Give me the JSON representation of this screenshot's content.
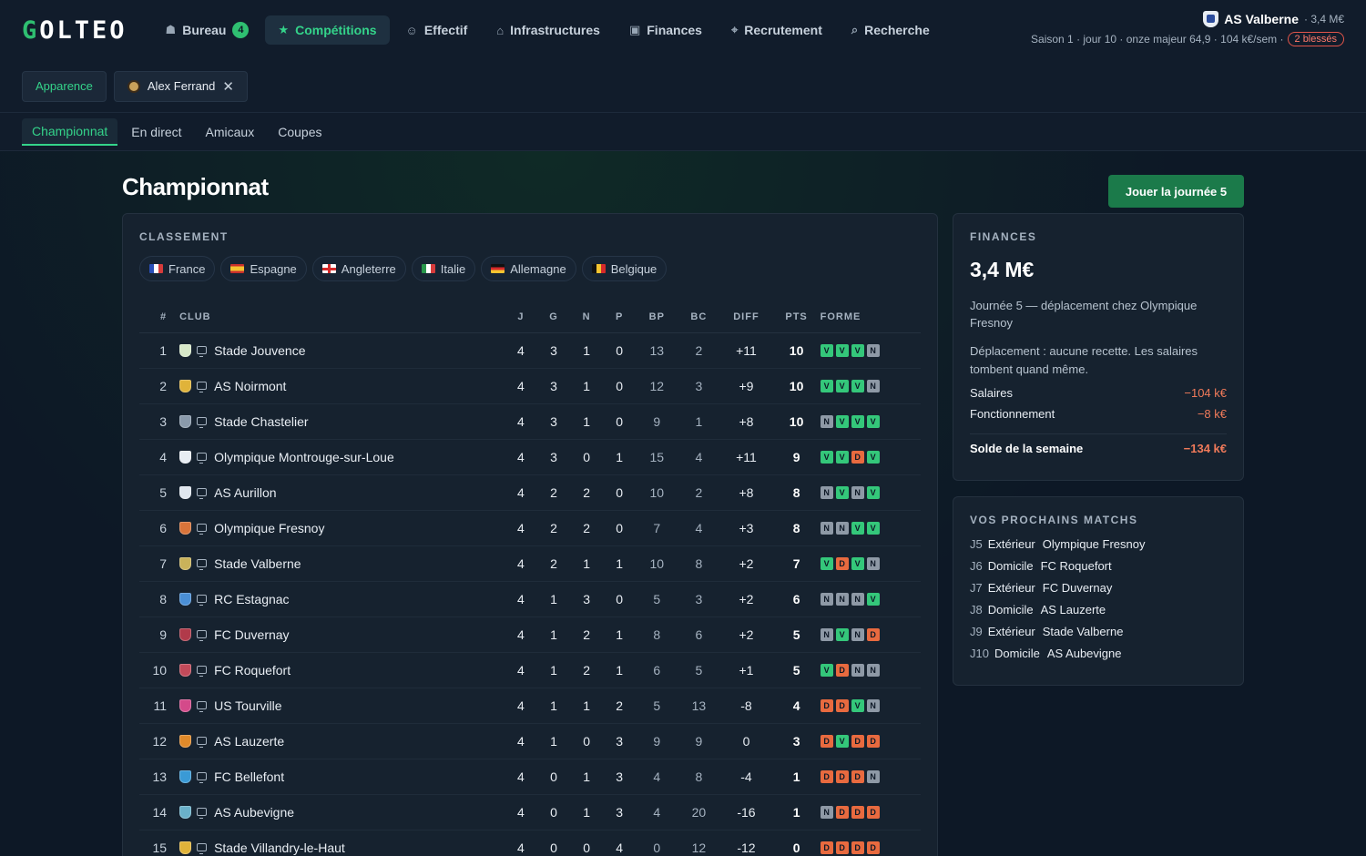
{
  "app": {
    "logo": "GOLTEO"
  },
  "nav": [
    {
      "label": "Bureau",
      "icon": "briefcase-icon",
      "glyph": "☗",
      "badge": "4",
      "active": false
    },
    {
      "label": "Compétitions",
      "icon": "trophy-icon",
      "glyph": "★",
      "badge": null,
      "active": true
    },
    {
      "label": "Effectif",
      "icon": "users-icon",
      "glyph": "☺",
      "badge": null,
      "active": false
    },
    {
      "label": "Infrastructures",
      "icon": "stadium-icon",
      "glyph": "⌂",
      "badge": null,
      "active": false
    },
    {
      "label": "Finances",
      "icon": "banknote-icon",
      "glyph": "▣",
      "badge": null,
      "active": false
    },
    {
      "label": "Recrutement",
      "icon": "scout-icon",
      "glyph": "⌖",
      "badge": null,
      "active": false
    },
    {
      "label": "Recherche",
      "icon": "search-icon",
      "glyph": "⌕",
      "badge": null,
      "active": false
    }
  ],
  "club": {
    "name": "AS Valberne",
    "budget": "· 3,4 M€",
    "status": "Saison 1 · jour 10 · onze majeur 64,9 · 104 k€/sem ·",
    "injuries": "2 blessés"
  },
  "toolbar": {
    "appearance": "Apparence",
    "user": "Alex Ferrand"
  },
  "tabs": [
    {
      "label": "Championnat",
      "active": true
    },
    {
      "label": "En direct",
      "active": false
    },
    {
      "label": "Amicaux",
      "active": false
    },
    {
      "label": "Coupes",
      "active": false
    }
  ],
  "page": {
    "title": "Championnat",
    "play_button": "Jouer la journée 5"
  },
  "standings": {
    "label": "CLASSEMENT",
    "countries": [
      {
        "name": "France",
        "flag": "flag-fr"
      },
      {
        "name": "Espagne",
        "flag": "flag-es"
      },
      {
        "name": "Angleterre",
        "flag": "flag-en"
      },
      {
        "name": "Italie",
        "flag": "flag-it"
      },
      {
        "name": "Allemagne",
        "flag": "flag-de"
      },
      {
        "name": "Belgique",
        "flag": "flag-be"
      }
    ],
    "columns": [
      "#",
      "CLUB",
      "J",
      "G",
      "N",
      "P",
      "BP",
      "BC",
      "DIFF",
      "PTS",
      "FORME"
    ],
    "rows": [
      {
        "pos": "1",
        "club": "Stade Jouvence",
        "crest": "#d7e8c9",
        "j": "4",
        "g": "3",
        "n": "1",
        "p": "0",
        "bp": "13",
        "bc": "2",
        "diff": "+11",
        "pts": "10",
        "form": [
          "V",
          "V",
          "V",
          "N"
        ]
      },
      {
        "pos": "2",
        "club": "AS Noirmont",
        "crest": "#e0b33a",
        "j": "4",
        "g": "3",
        "n": "1",
        "p": "0",
        "bp": "12",
        "bc": "3",
        "diff": "+9",
        "pts": "10",
        "form": [
          "V",
          "V",
          "V",
          "N"
        ]
      },
      {
        "pos": "3",
        "club": "Stade Chastelier",
        "crest": "#8a9aab",
        "j": "4",
        "g": "3",
        "n": "1",
        "p": "0",
        "bp": "9",
        "bc": "1",
        "diff": "+8",
        "pts": "10",
        "form": [
          "N",
          "V",
          "V",
          "V"
        ]
      },
      {
        "pos": "4",
        "club": "Olympique Montrouge-sur-Loue",
        "crest": "#e8edf3",
        "j": "4",
        "g": "3",
        "n": "0",
        "p": "1",
        "bp": "15",
        "bc": "4",
        "diff": "+11",
        "pts": "9",
        "form": [
          "V",
          "V",
          "D",
          "V"
        ]
      },
      {
        "pos": "5",
        "club": "AS Aurillon",
        "crest": "#dfe6ee",
        "j": "4",
        "g": "2",
        "n": "2",
        "p": "0",
        "bp": "10",
        "bc": "2",
        "diff": "+8",
        "pts": "8",
        "form": [
          "N",
          "V",
          "N",
          "V"
        ]
      },
      {
        "pos": "6",
        "club": "Olympique Fresnoy",
        "crest": "#d9743a",
        "j": "4",
        "g": "2",
        "n": "2",
        "p": "0",
        "bp": "7",
        "bc": "4",
        "diff": "+3",
        "pts": "8",
        "form": [
          "N",
          "N",
          "V",
          "V"
        ]
      },
      {
        "pos": "7",
        "club": "Stade Valberne",
        "crest": "#c9b25a",
        "j": "4",
        "g": "2",
        "n": "1",
        "p": "1",
        "bp": "10",
        "bc": "8",
        "diff": "+2",
        "pts": "7",
        "form": [
          "V",
          "D",
          "V",
          "N"
        ]
      },
      {
        "pos": "8",
        "club": "RC Estagnac",
        "crest": "#4a8fd6",
        "j": "4",
        "g": "1",
        "n": "3",
        "p": "0",
        "bp": "5",
        "bc": "3",
        "diff": "+2",
        "pts": "6",
        "form": [
          "N",
          "N",
          "N",
          "V"
        ]
      },
      {
        "pos": "9",
        "club": "FC Duvernay",
        "crest": "#b13a4a",
        "j": "4",
        "g": "1",
        "n": "2",
        "p": "1",
        "bp": "8",
        "bc": "6",
        "diff": "+2",
        "pts": "5",
        "form": [
          "N",
          "V",
          "N",
          "D"
        ]
      },
      {
        "pos": "10",
        "club": "FC Roquefort",
        "crest": "#c24a5a",
        "j": "4",
        "g": "1",
        "n": "2",
        "p": "1",
        "bp": "6",
        "bc": "5",
        "diff": "+1",
        "pts": "5",
        "form": [
          "V",
          "D",
          "N",
          "N"
        ]
      },
      {
        "pos": "11",
        "club": "US Tourville",
        "crest": "#d44a8a",
        "j": "4",
        "g": "1",
        "n": "1",
        "p": "2",
        "bp": "5",
        "bc": "13",
        "diff": "-8",
        "pts": "4",
        "form": [
          "D",
          "D",
          "V",
          "N"
        ]
      },
      {
        "pos": "12",
        "club": "AS Lauzerte",
        "crest": "#e08a2a",
        "j": "4",
        "g": "1",
        "n": "0",
        "p": "3",
        "bp": "9",
        "bc": "9",
        "diff": "0",
        "pts": "3",
        "form": [
          "D",
          "V",
          "D",
          "D"
        ]
      },
      {
        "pos": "13",
        "club": "FC Bellefont",
        "crest": "#3a9ad6",
        "j": "4",
        "g": "0",
        "n": "1",
        "p": "3",
        "bp": "4",
        "bc": "8",
        "diff": "-4",
        "pts": "1",
        "form": [
          "D",
          "D",
          "D",
          "N"
        ]
      },
      {
        "pos": "14",
        "club": "AS Aubevigne",
        "crest": "#6ab0c9",
        "j": "4",
        "g": "0",
        "n": "1",
        "p": "3",
        "bp": "4",
        "bc": "20",
        "diff": "-16",
        "pts": "1",
        "form": [
          "N",
          "D",
          "D",
          "D"
        ]
      },
      {
        "pos": "15",
        "club": "Stade Villandry-le-Haut",
        "crest": "#e0b33a",
        "j": "4",
        "g": "0",
        "n": "0",
        "p": "4",
        "bp": "0",
        "bc": "12",
        "diff": "-12",
        "pts": "0",
        "form": [
          "D",
          "D",
          "D",
          "D"
        ]
      }
    ]
  },
  "finances": {
    "label": "FINANCES",
    "amount": "3,4 M€",
    "note": "Journée 5 — déplacement chez Olympique Fresnoy",
    "note2": "Déplacement : aucune recette. Les salaires tombent quand même.",
    "rows": [
      {
        "label": "Salaires",
        "value": "−104 k€"
      },
      {
        "label": "Fonctionnement",
        "value": "−8 k€"
      }
    ],
    "total": {
      "label": "Solde de la semaine",
      "value": "−134 k€"
    }
  },
  "upcoming": {
    "label": "VOS PROCHAINS MATCHS",
    "matches": [
      {
        "md": "J5",
        "venue": "Extérieur",
        "opponent": "Olympique Fresnoy"
      },
      {
        "md": "J6",
        "venue": "Domicile",
        "opponent": "FC Roquefort"
      },
      {
        "md": "J7",
        "venue": "Extérieur",
        "opponent": "FC Duvernay"
      },
      {
        "md": "J8",
        "venue": "Domicile",
        "opponent": "AS Lauzerte"
      },
      {
        "md": "J9",
        "venue": "Extérieur",
        "opponent": "Stade Valberne"
      },
      {
        "md": "J10",
        "venue": "Domicile",
        "opponent": "AS Aubevigne"
      }
    ]
  }
}
